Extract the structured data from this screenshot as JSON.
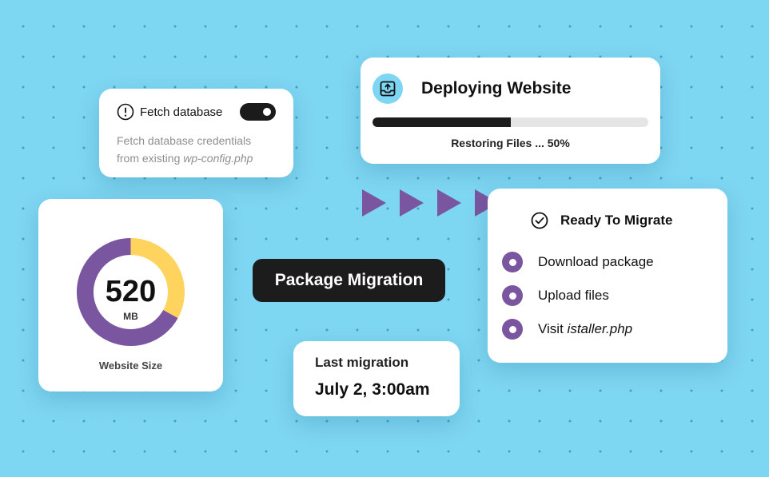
{
  "fetch_card": {
    "title": "Fetch database",
    "description": "Fetch database credentials from existing",
    "description_file": "wp-config.php",
    "toggle_on": true,
    "icon": "info-circle-icon"
  },
  "deploy_card": {
    "title": "Deploying Website",
    "icon": "download-tray-icon",
    "progress_percent": 50,
    "status": "Restoring Files ... 50%"
  },
  "size_card": {
    "value": "520",
    "unit": "MB",
    "label": "Website Size",
    "donut": {
      "purple_fraction": 0.67,
      "yellow_fraction": 0.33,
      "purple": "#7a55a0",
      "yellow": "#ffd45e"
    }
  },
  "package_label": "Package Migration",
  "last_card": {
    "label": "Last migration",
    "value": "July 2, 3:00am"
  },
  "ready_card": {
    "title": "Ready To Migrate",
    "icon": "check-circle-icon",
    "items": [
      {
        "text": "Download package",
        "italic": ""
      },
      {
        "text": "Upload files",
        "italic": ""
      },
      {
        "text": "Visit",
        "italic": "istaller.php"
      }
    ]
  },
  "colors": {
    "background": "#7dd6f2",
    "accent_purple": "#7a55a0",
    "dark": "#1c1c1c"
  }
}
